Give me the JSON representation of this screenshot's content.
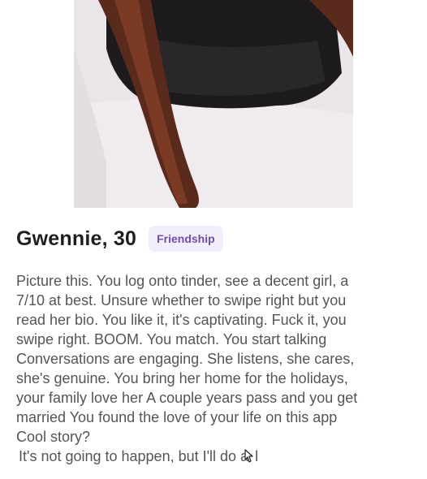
{
  "profile": {
    "name_age": "Gwennie, 30",
    "intent_badge": "Friendship",
    "bio": "Picture this. You log onto tinder, see a decent girl, a\n7/10 at best. Unsure whether to swipe right but you\nread her bio. You like it, it's captivating. Fuck it, you\nswipe right. BOOM. You match. You start talking\nConversations are engaging. She listens, she cares,\nshe's genuine. You bring her home for the holidays,\nyour family love her A couple years pass and you get\nmarried You found the love of your life on this app\nCool story?",
    "bio_tail": "It's not going to happen, but I'll do a",
    "bio_tail_end": "l"
  },
  "colors": {
    "badge_bg": "#f3effa",
    "badge_text": "#6f4fa8",
    "body_text": "#555555"
  },
  "icons": {
    "cursor": "pointer-cursor-icon"
  }
}
